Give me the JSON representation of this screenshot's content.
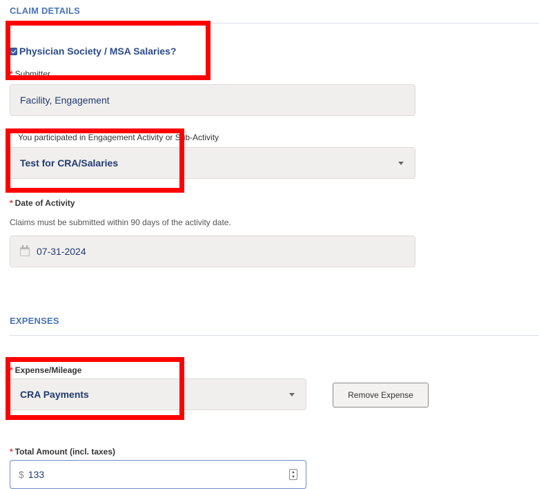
{
  "claim_details": {
    "title": "CLAIM DETAILS",
    "physician_checkbox": {
      "label": "Physician Society / MSA Salaries?",
      "checked": true
    },
    "submitter": {
      "label": "Submitter",
      "value": "Facility, Engagement"
    },
    "activity": {
      "label": "You participated in Engagement Activity or Sub-Activity",
      "value": "Test for CRA/Salaries"
    },
    "date": {
      "label": "Date of Activity",
      "help": "Claims must be submitted within 90 days of the activity date.",
      "value": "07-31-2024"
    }
  },
  "expenses": {
    "title": "EXPENSES",
    "expense_type": {
      "label": "Expense/Mileage",
      "value": "CRA Payments"
    },
    "remove_button": "Remove Expense",
    "total_amount": {
      "label": "Total Amount (incl. taxes)",
      "currency": "$",
      "value": "133"
    }
  },
  "colors": {
    "accent": "#4a74b8",
    "required": "#d9342b",
    "highlight": "#ff0000"
  }
}
